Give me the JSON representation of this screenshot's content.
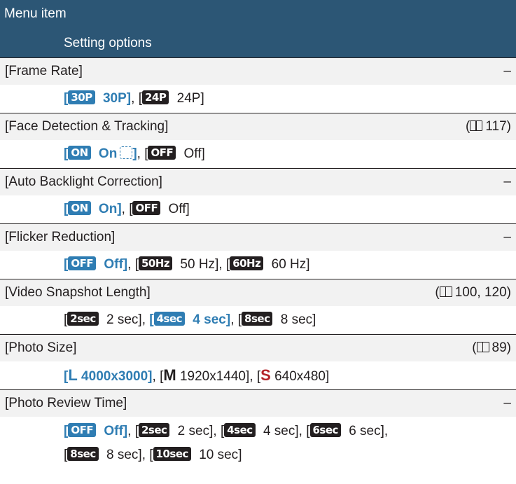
{
  "header": {
    "menu_item": "Menu item",
    "setting_options": "Setting options"
  },
  "colors": {
    "header_bg": "#2c5675",
    "default_option": "#2f7db3",
    "icon_dark": "#231f20"
  },
  "rows": [
    {
      "name": "[Frame Rate]",
      "ref": "–",
      "options": [
        {
          "open": "[",
          "icon": "30P",
          "label": " 30P",
          "close": "]",
          "default": true
        },
        {
          "open": "[",
          "icon": "24P",
          "label": " 24P",
          "close": "]",
          "default": false
        }
      ]
    },
    {
      "name": "[Face Detection & Tracking]",
      "ref_open": "(",
      "ref_pages": "117)",
      "options": [
        {
          "open": "[",
          "icon": "ON",
          "label": " On",
          "close": "]",
          "default": true
        },
        {
          "open": "[",
          "icon": "OFF",
          "label": " Off",
          "close": "]",
          "default": false
        }
      ]
    },
    {
      "name": "[Auto Backlight Correction]",
      "ref": "–",
      "options": [
        {
          "open": "[",
          "icon": "ON",
          "label": " On",
          "close": "]",
          "default": true
        },
        {
          "open": "[",
          "icon": "OFF",
          "label": " Off",
          "close": "]",
          "default": false
        }
      ]
    },
    {
      "name": "[Flicker Reduction]",
      "ref": "–",
      "options": [
        {
          "open": "[",
          "icon": "OFF",
          "label": " Off",
          "close": "]",
          "default": true
        },
        {
          "open": "[",
          "icon": "50Hz",
          "label": " 50 Hz",
          "close": "]",
          "default": false
        },
        {
          "open": "[",
          "icon": "60Hz",
          "label": " 60 Hz",
          "close": "]",
          "default": false
        }
      ]
    },
    {
      "name": "[Video Snapshot Length]",
      "ref_open": "(",
      "ref_pages": "100, 120)",
      "options": [
        {
          "open": "[",
          "icon": "2sec",
          "label": " 2 sec",
          "close": "]",
          "default": false
        },
        {
          "open": "[",
          "icon": "4sec",
          "label": " 4 sec",
          "close": "]",
          "default": true
        },
        {
          "open": "[",
          "icon": "8sec",
          "label": " 8 sec",
          "close": "]",
          "default": false
        }
      ]
    },
    {
      "name": "[Photo Size]",
      "ref_open": "(",
      "ref_pages": "89)",
      "options": [
        {
          "open": "[",
          "glyph": "L",
          "label": " 4000x3000",
          "close": "]",
          "default": true
        },
        {
          "open": "[",
          "glyph": "M",
          "label": " 1920x1440",
          "close": "]",
          "default": false
        },
        {
          "open": "[",
          "glyph": "S",
          "label": " 640x480",
          "close": "]",
          "default": false
        }
      ]
    },
    {
      "name": "[Photo Review Time]",
      "ref": "–",
      "options_line1": [
        {
          "open": "[",
          "icon": "OFF",
          "label": " Off",
          "close": "]",
          "default": true
        },
        {
          "open": "[",
          "icon": "2sec",
          "label": " 2 sec",
          "close": "]",
          "default": false
        },
        {
          "open": "[",
          "icon": "4sec",
          "label": " 4 sec",
          "close": "]",
          "default": false
        },
        {
          "open": "[",
          "icon": "6sec",
          "label": " 6 sec",
          "close": "],",
          "default": false
        }
      ],
      "options_line2": [
        {
          "open": "[",
          "icon": "8sec",
          "label": " 8 sec",
          "close": "]",
          "default": false
        },
        {
          "open": "[",
          "icon": "10sec",
          "label": " 10 sec",
          "close": "]",
          "default": false
        }
      ]
    }
  ]
}
